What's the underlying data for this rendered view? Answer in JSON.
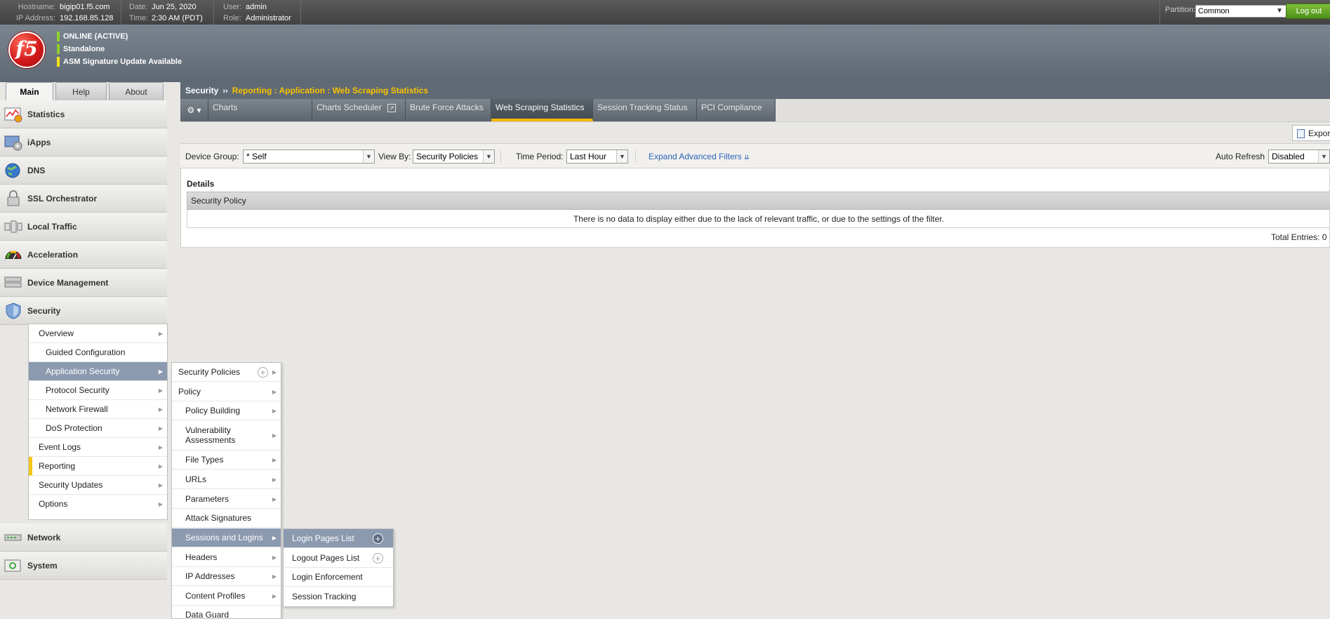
{
  "topbar": {
    "hostname_label": "Hostname:",
    "hostname": "bigip01.f5.com",
    "ip_label": "IP Address:",
    "ip": "192.168.85.128",
    "date_label": "Date:",
    "date": "Jun 25, 2020",
    "time_label": "Time:",
    "time": "2:30 AM (PDT)",
    "user_label": "User:",
    "user": "admin",
    "role_label": "Role:",
    "role": "Administrator",
    "partition_label": "Partition:",
    "partition_value": "Common",
    "logout_label": "Log out"
  },
  "logo_text": "f5",
  "status": {
    "online": "ONLINE (ACTIVE)",
    "mode": "Standalone",
    "asm": "ASM Signature Update Available",
    "colors": {
      "online": "#8fd12a",
      "mode": "#8fd12a",
      "asm": "#f5e216"
    }
  },
  "left_tabs": [
    "Main",
    "Help",
    "About"
  ],
  "nav": {
    "statistics": "Statistics",
    "iapps": "iApps",
    "dns": "DNS",
    "ssl": "SSL Orchestrator",
    "local_traffic": "Local Traffic",
    "acceleration": "Acceleration",
    "device_management": "Device Management",
    "security": "Security",
    "network": "Network",
    "system": "System"
  },
  "security_menu": {
    "overview": "Overview",
    "guided": "Guided Configuration",
    "app_security": "Application Security",
    "protocol": "Protocol Security",
    "network_firewall": "Network Firewall",
    "dos": "DoS Protection",
    "event_logs": "Event Logs",
    "reporting": "Reporting",
    "updates": "Security Updates",
    "options": "Options"
  },
  "app_menu": {
    "security_policies": "Security Policies",
    "policy": "Policy",
    "policy_building": "Policy Building",
    "vuln": "Vulnerability Assessments",
    "file_types": "File Types",
    "urls": "URLs",
    "parameters": "Parameters",
    "attack_signatures": "Attack Signatures",
    "sessions": "Sessions and Logins",
    "headers": "Headers",
    "ip_addresses": "IP Addresses",
    "content_profiles": "Content Profiles",
    "data_guard": "Data Guard"
  },
  "sessions_menu": {
    "login_pages": "Login Pages List",
    "logout_pages": "Logout Pages List",
    "login_enforcement": "Login Enforcement",
    "session_tracking": "Session Tracking"
  },
  "breadcrumb": {
    "root": "Security",
    "separator": "››",
    "path": "Reporting : Application : Web Scraping Statistics"
  },
  "content_tabs": {
    "charts": "Charts",
    "charts_scheduler": "Charts Scheduler",
    "brute_force": "Brute Force Attacks",
    "web_scraping": "Web Scraping Statistics",
    "session_tracking": "Session Tracking Status",
    "pci": "PCI Compliance"
  },
  "export_label": "Export",
  "filters": {
    "device_group_label": "Device Group:",
    "device_group_value": "* Self",
    "view_by_label": "View By:",
    "view_by_value": "Security Policies",
    "time_period_label": "Time Period:",
    "time_period_value": "Last Hour",
    "expand_link": "Expand Advanced Filters",
    "auto_refresh_label": "Auto Refresh",
    "auto_refresh_value": "Disabled"
  },
  "details": {
    "title": "Details",
    "column": "Security Policy",
    "empty_message": "There is no data to display either due to the lack of relevant traffic, or due to the settings of the filter.",
    "total_label": "Total Entries: 0"
  }
}
